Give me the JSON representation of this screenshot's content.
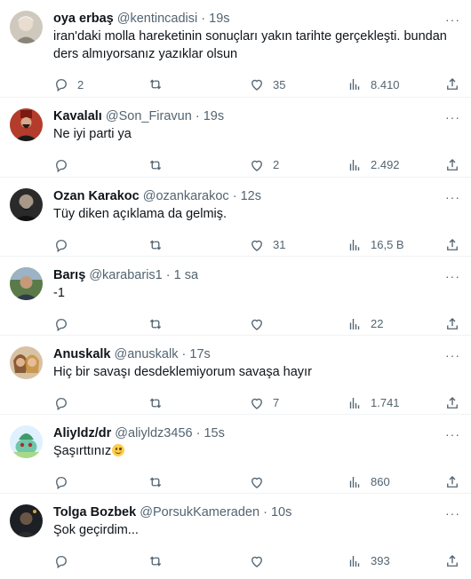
{
  "tweets": [
    {
      "name": "oya erbaş",
      "handle": "@kentincadisi",
      "dot": "·",
      "time": "19s",
      "text": "iran'daki molla hareketinin sonuçları yakın tarihte gerçekleşti. bundan ders almıyorsanız yazıklar olsun",
      "replies": "2",
      "retweets": "",
      "likes": "35",
      "views": "8.410",
      "avatar": "avatar-elderly-woman"
    },
    {
      "name": "Kavalalı",
      "handle": "@Son_Firavun",
      "dot": "·",
      "time": "19s",
      "text": "Ne iyi parti ya",
      "replies": "",
      "retweets": "",
      "likes": "2",
      "views": "2.492",
      "avatar": "avatar-pasha-portrait"
    },
    {
      "name": "Ozan Karakoc",
      "handle": "@ozankarakoc",
      "dot": "·",
      "time": "12s",
      "text": "Tüy diken açıklama da gelmiş.",
      "replies": "",
      "retweets": "",
      "likes": "31",
      "views": "16,5 B",
      "avatar": "avatar-bearded-man"
    },
    {
      "name": "Barış",
      "handle": "@karabaris1",
      "dot": "·",
      "time": "1 sa",
      "text": "-1",
      "replies": "",
      "retweets": "",
      "likes": "",
      "views": "22",
      "avatar": "avatar-man-outdoor"
    },
    {
      "name": "Anuskalk",
      "handle": "@anuskalk",
      "dot": "·",
      "time": "17s",
      "text": "Hiç bir savaşı desdeklemiyorum savaşa hayır",
      "replies": "",
      "retweets": "",
      "likes": "7",
      "views": "1.741",
      "avatar": "avatar-two-women"
    },
    {
      "name": "Aliyldz/dr",
      "handle": "@aliyldz3456",
      "dot": "·",
      "time": "15s",
      "text": "Şaşırttınız",
      "emoji": "smiling-face-emoji",
      "replies": "",
      "retweets": "",
      "likes": "",
      "views": "860",
      "avatar": "avatar-cartoon-creature"
    },
    {
      "name": "Tolga Bozbek",
      "handle": "@PorsukKameraden",
      "dot": "·",
      "time": "10s",
      "text": "Şok geçirdim...",
      "replies": "",
      "retweets": "",
      "likes": "",
      "views": "393",
      "avatar": "avatar-dark-photo"
    }
  ],
  "more_label": "···",
  "colors": {
    "name": "#0f1419",
    "secondary": "#536471",
    "divider": "#eff3f4",
    "background": "#ffffff"
  }
}
